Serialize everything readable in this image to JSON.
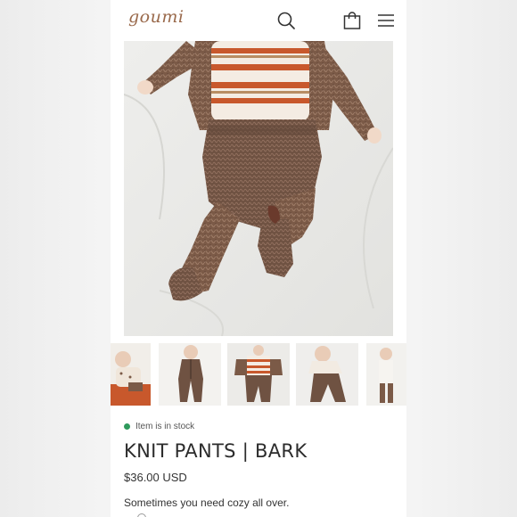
{
  "header": {
    "logo_text": "goumi",
    "icons": [
      "search-icon",
      "shopping-bag-icon",
      "menu-icon"
    ]
  },
  "gallery": {
    "main_image": "baby wearing brown knit pants, cardigan and striped top",
    "thumbnail_count": 5,
    "active_thumbnail": 3
  },
  "product": {
    "stock_status": "Item is in stock",
    "title": "KNIT PANTS | BARK",
    "price": "$36.00 USD",
    "description": "Sometimes you need cozy all over."
  },
  "colors": {
    "accent_brand": "#9a6a4c",
    "in_stock": "#2f9a5c",
    "knit_brown": "#7a5a48",
    "stripe_orange": "#c8582c"
  }
}
